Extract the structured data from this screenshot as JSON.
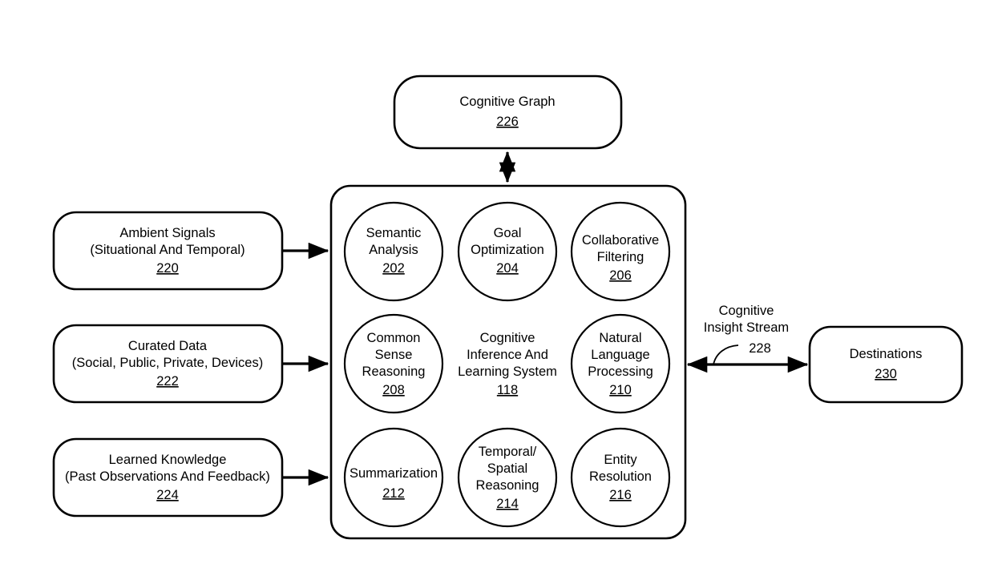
{
  "figure": {
    "type": "patent-block-diagram",
    "background_color": "#ffffff",
    "line_color": "#000000"
  },
  "cognitive_graph": {
    "title": "Cognitive Graph",
    "ref": "226"
  },
  "inputs": [
    {
      "line1": "Ambient Signals",
      "line2": "(Situational And Temporal)",
      "ref": "220"
    },
    {
      "line1": "Curated Data",
      "line2": "(Social, Public, Private, Devices)",
      "ref": "222"
    },
    {
      "line1": "Learned Knowledge",
      "line2": "(Past Observations And Feedback)",
      "ref": "224"
    }
  ],
  "system": {
    "center_label": {
      "line1": "Cognitive",
      "line2": "Inference And",
      "line3": "Learning System",
      "ref": "118"
    },
    "components": [
      {
        "line1": "Semantic",
        "line2": "Analysis",
        "ref": "202"
      },
      {
        "line1": "Goal",
        "line2": "Optimization",
        "ref": "204"
      },
      {
        "line1": "Collaborative",
        "line2": "Filtering",
        "ref": "206"
      },
      {
        "line1": "Common",
        "line2": "Sense",
        "line3": "Reasoning",
        "ref": "208"
      },
      {
        "line1": "Natural",
        "line2": "Language",
        "line3": "Processing",
        "ref": "210"
      },
      {
        "line1": "Summarization",
        "ref": "212"
      },
      {
        "line1": "Temporal/",
        "line2": "Spatial",
        "line3": "Reasoning",
        "ref": "214"
      },
      {
        "line1": "Entity",
        "line2": "Resolution",
        "ref": "216"
      }
    ]
  },
  "output_stream": {
    "line1": "Cognitive",
    "line2": "Insight Stream",
    "ref": "228"
  },
  "destinations": {
    "title": "Destinations",
    "ref": "230"
  }
}
